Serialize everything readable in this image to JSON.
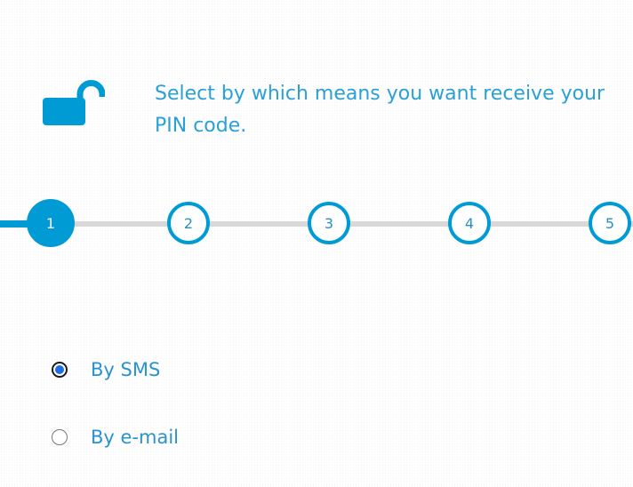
{
  "header": {
    "icon": "unlocked-padlock-icon",
    "instruction": "Select by which means you want receive your PIN code."
  },
  "stepper": {
    "current_step": 1,
    "steps": [
      {
        "label": "1"
      },
      {
        "label": "2"
      },
      {
        "label": "3"
      },
      {
        "label": "4"
      },
      {
        "label": "5"
      }
    ]
  },
  "options": [
    {
      "label": "By SMS",
      "selected": true
    },
    {
      "label": "By e-mail",
      "selected": false
    }
  ],
  "colors": {
    "accent": "#009bd5",
    "text_blue": "#2aa0d6",
    "track": "#d8d8d8",
    "radio_selected": "#1b6ee6"
  }
}
